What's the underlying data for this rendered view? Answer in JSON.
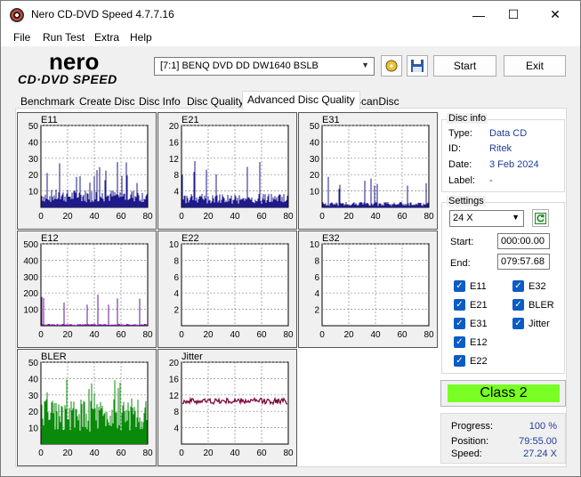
{
  "window": {
    "title": "Nero CD-DVD Speed 4.7.7.16",
    "minimize": "—",
    "maximize": "☐",
    "close": "✕"
  },
  "menu": [
    "File",
    "Run Test",
    "Extra",
    "Help"
  ],
  "logo": {
    "top": "nero",
    "bottom": "CD·DVD SPEED"
  },
  "toolbar": {
    "drive": "[7:1]   BENQ DVD DD DW1640 BSLB",
    "start": "Start",
    "exit": "Exit"
  },
  "tabs": [
    "Benchmark",
    "Create Disc",
    "Disc Info",
    "Disc Quality",
    "Advanced Disc Quality",
    "ScanDisc"
  ],
  "active_tab": "Advanced Disc Quality",
  "disc_info": {
    "title": "Disc info",
    "type_label": "Type:",
    "type": "Data CD",
    "id_label": "ID:",
    "id": "Ritek",
    "date_label": "Date:",
    "date": "3 Feb 2024",
    "label_label": "Label:",
    "label": "-"
  },
  "settings": {
    "title": "Settings",
    "speed": "24 X",
    "start_label": "Start:",
    "start": "000:00.00",
    "end_label": "End:",
    "end": "079:57.68",
    "checks": [
      "E11",
      "E32",
      "E21",
      "BLER",
      "E31",
      "Jitter",
      "E12",
      "E22"
    ]
  },
  "class": "Class 2",
  "stats": {
    "progress_label": "Progress:",
    "progress": "100 %",
    "position_label": "Position:",
    "position": "79:55.00",
    "speed_label": "Speed:",
    "speed": "27.24 X"
  },
  "colors": {
    "accent": "#0b5cc4",
    "class_bg": "#79ff24",
    "value_text": "#1f3c99"
  },
  "chart_data": [
    {
      "name": "E11",
      "type": "bar",
      "color": "#1e1a8a",
      "ymax": 50,
      "yticks": [
        10,
        20,
        30,
        40,
        50
      ],
      "xticks": [
        0,
        20,
        40,
        60,
        80
      ],
      "level": 10,
      "spike": 28
    },
    {
      "name": "E21",
      "type": "bar",
      "color": "#1e1a8a",
      "ymax": 20,
      "yticks": [
        4,
        8,
        12,
        16,
        20
      ],
      "xticks": [
        0,
        20,
        40,
        60,
        80
      ],
      "level": 3,
      "spike": 12
    },
    {
      "name": "E31",
      "type": "bar",
      "color": "#1e1a8a",
      "ymax": 50,
      "yticks": [
        10,
        20,
        30,
        40,
        50
      ],
      "xticks": [
        0,
        20,
        40,
        60,
        80
      ],
      "level": 3,
      "spike": 20
    },
    {
      "name": "E12",
      "type": "bar",
      "color": "#6a0f96",
      "ymax": 500,
      "yticks": [
        100,
        200,
        300,
        400,
        500
      ],
      "xticks": [
        0,
        20,
        40,
        60,
        80
      ],
      "level": 10,
      "spike": 200
    },
    {
      "name": "E22",
      "type": "bar",
      "color": "#1e1a8a",
      "ymax": 10,
      "yticks": [
        2,
        4,
        6,
        8,
        10
      ],
      "xticks": [
        0,
        20,
        40,
        60,
        80
      ],
      "level": 0,
      "spike": 0
    },
    {
      "name": "E32",
      "type": "bar",
      "color": "#1e1a8a",
      "ymax": 10,
      "yticks": [
        2,
        4,
        6,
        8,
        10
      ],
      "xticks": [
        0,
        20,
        40,
        60,
        80
      ],
      "level": 0,
      "spike": 0
    },
    {
      "name": "BLER",
      "type": "bar",
      "color": "#0a8a0a",
      "ymax": 50,
      "yticks": [
        10,
        20,
        30,
        40,
        50
      ],
      "xticks": [
        0,
        20,
        40,
        60,
        80
      ],
      "level": 25,
      "spike": 40
    },
    {
      "name": "Jitter",
      "type": "line",
      "color": "#7a0a3a",
      "ymax": 20,
      "yticks": [
        4,
        8,
        12,
        16,
        20
      ],
      "xticks": [
        0,
        20,
        40,
        60,
        80
      ],
      "level": 10.5,
      "spike": 11.5
    }
  ]
}
